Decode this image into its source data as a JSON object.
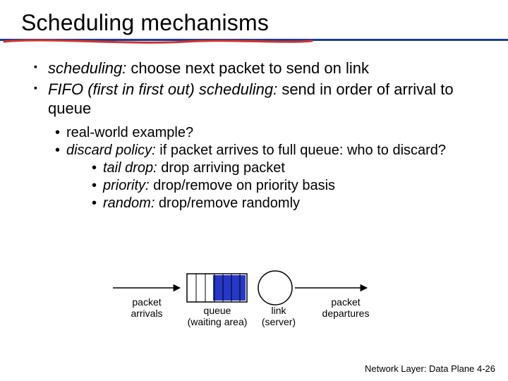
{
  "title": "Scheduling mechanisms",
  "bullets": {
    "b1_term": "scheduling:",
    "b1_rest": " choose next packet to send on link",
    "b2_term": "FIFO (first in first out) scheduling:",
    "b2_rest": " send in order of arrival to queue"
  },
  "sub": {
    "s1": "real-world example?",
    "s2_term": "discard policy:",
    "s2_rest": " if packet arrives to full queue: who to discard?",
    "s2a_term": "tail drop:",
    "s2a_rest": " drop arriving packet",
    "s2b_term": "priority:",
    "s2b_rest": " drop/remove on priority basis",
    "s2c_term": "random:",
    "s2c_rest": " drop/remove randomly"
  },
  "diagram": {
    "arrivals": "packet\narrivals",
    "queue_l1": "queue",
    "queue_l2": "(waiting area)",
    "link_l1": "link",
    "link_l2": "(server)",
    "departures": "packet\ndepartures"
  },
  "footer": "Network Layer: Data Plane  4-26"
}
